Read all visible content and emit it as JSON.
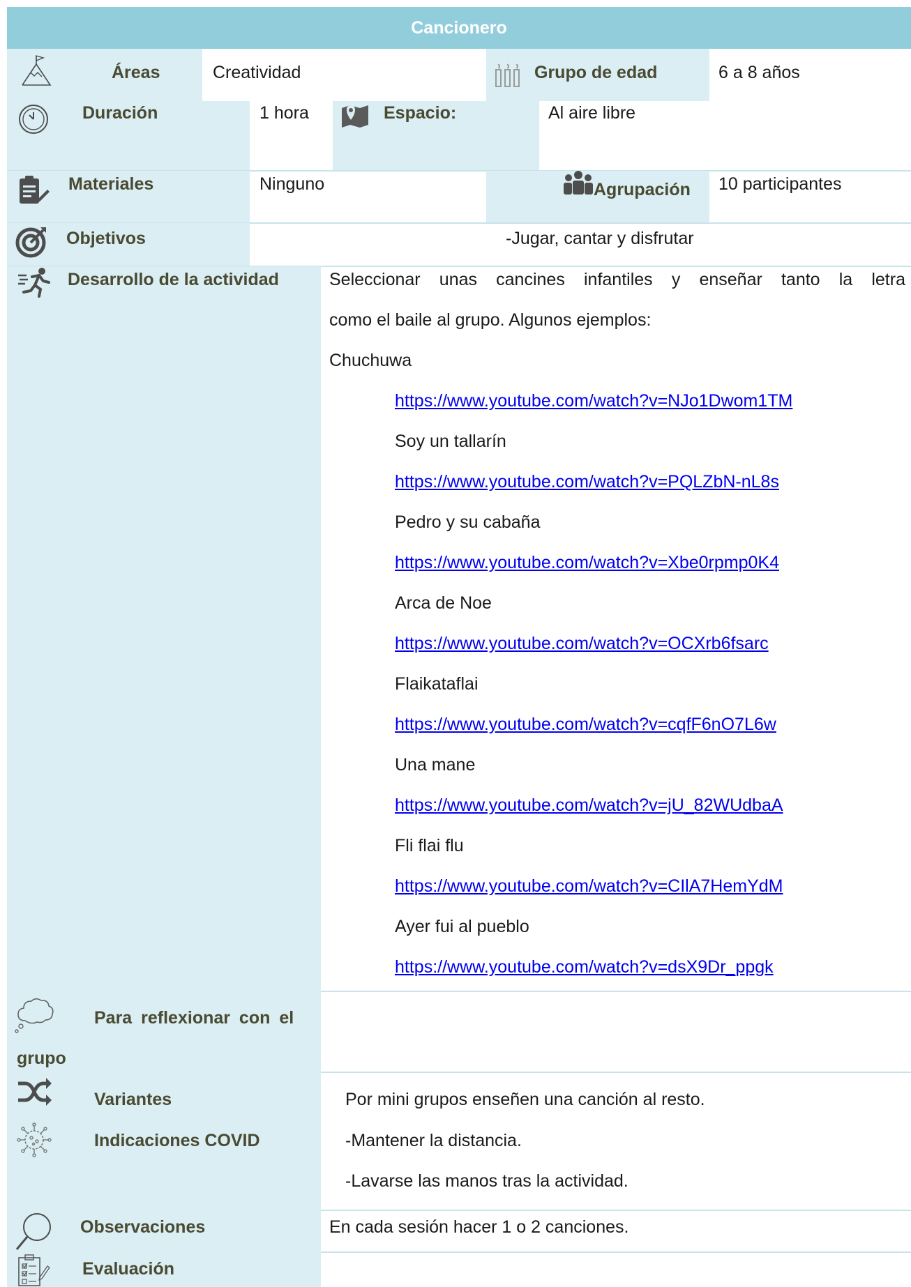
{
  "title": "Cancionero",
  "rows": {
    "areas": {
      "label": "Áreas",
      "value": "Creatividad",
      "label2": "Grupo de edad",
      "value2": "6 a 8 años"
    },
    "duracion": {
      "label": "Duración",
      "value": "1 hora",
      "label2": "Espacio:",
      "value2": "Al aire libre"
    },
    "materiales": {
      "label": "Materiales",
      "value": "Ninguno",
      "label2": "Agrupación",
      "value2": "10 participantes"
    },
    "objetivos": {
      "label": "Objetivos",
      "value": "-Jugar, cantar y disfrutar"
    },
    "desarrollo": {
      "label": "Desarrollo de la actividad",
      "intro_line1": "Seleccionar unas cancines infantiles y enseñar tanto la letra",
      "intro_line2": "como el baile al grupo. Algunos ejemplos:",
      "songs": [
        {
          "name": "Chuchuwa",
          "url": "https://www.youtube.com/watch?v=NJo1Dwom1TM"
        },
        {
          "name": "Soy un tallarín",
          "url": "https://www.youtube.com/watch?v=PQLZbN-nL8s"
        },
        {
          "name": "Pedro y su cabaña",
          "url": "https://www.youtube.com/watch?v=Xbe0rpmp0K4"
        },
        {
          "name": "Arca de Noe",
          "url": "https://www.youtube.com/watch?v=OCXrb6fsarc"
        },
        {
          "name": "Flaikataflai",
          "url": "https://www.youtube.com/watch?v=cqfF6nO7L6w"
        },
        {
          "name": "Una mane",
          "url": "https://www.youtube.com/watch?v=jU_82WUdbaA"
        },
        {
          "name": "Fli flai flu",
          "url": "https://www.youtube.com/watch?v=CIlA7HemYdM"
        },
        {
          "name": "Ayer fui al pueblo",
          "url": "https://www.youtube.com/watch?v=dsX9Dr_ppgk"
        }
      ]
    },
    "reflexionar": {
      "label_line1": "Para reflexionar con el",
      "label_line2": "grupo",
      "value": ""
    },
    "variantes": {
      "label": "Variantes",
      "value": "Por mini grupos enseñen una canción al resto."
    },
    "covid": {
      "label": "Indicaciones COVID",
      "value_line1": "-Mantener la distancia.",
      "value_line2": "-Lavarse las manos tras la actividad."
    },
    "observaciones": {
      "label": "Observaciones",
      "value": "En cada sesión hacer 1 o 2 canciones."
    },
    "evaluacion": {
      "label": "Evaluación",
      "value": ""
    }
  },
  "icons": {
    "areas": "mountain-flag-icon",
    "edad": "birthday-candles-icon",
    "duracion": "clock-icon",
    "espacio": "map-pin-icon",
    "materiales": "clipboard-pen-icon",
    "agrupacion": "group-people-icon",
    "objetivos": "target-icon",
    "desarrollo": "running-person-icon",
    "reflexionar": "thought-cloud-icon",
    "variantes": "shuffle-icon",
    "covid": "virus-icon",
    "observaciones": "magnifier-icon",
    "evaluacion": "checklist-icon"
  },
  "colors": {
    "header": "#92cddc",
    "band": "#daeef3",
    "link": "#0000ee",
    "label": "#4a4a32"
  }
}
